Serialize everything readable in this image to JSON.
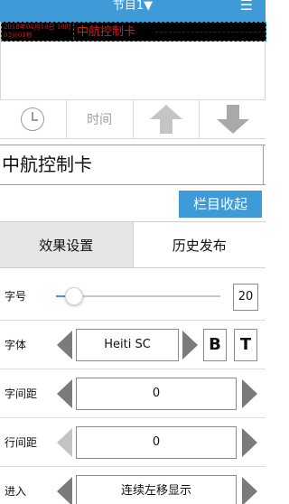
{
  "header": {
    "title": "节目1▼",
    "menu_icon": "hamburger-icon"
  },
  "preview": {
    "time_text": "2018年04月10日 10时03分01秒",
    "message": "中航控制卡"
  },
  "toolbar": {
    "clock_icon": "clock-icon",
    "time_label": "时间",
    "up_icon": "arrow-up-icon",
    "down_icon": "arrow-down-icon"
  },
  "text_input": {
    "value": "中航控制卡"
  },
  "collapse_button": "栏目收起",
  "tabs": [
    {
      "label": "效果设置",
      "active": true
    },
    {
      "label": "历史发布",
      "active": false
    }
  ],
  "settings": {
    "font_size": {
      "label": "字号",
      "value": "20",
      "slider_fraction": 0.08
    },
    "font": {
      "label": "字体",
      "value": "Heiti SC",
      "bold_label": "B",
      "type_label": "T"
    },
    "char_spacing": {
      "label": "字间距",
      "value": "0"
    },
    "line_spacing": {
      "label": "行间距",
      "value": "0"
    },
    "enter": {
      "label": "进入",
      "value": "连续左移显示"
    }
  },
  "colors": {
    "accent": "#3f9ad8",
    "led_text": "#d21c1c",
    "led_bg": "#000000"
  }
}
